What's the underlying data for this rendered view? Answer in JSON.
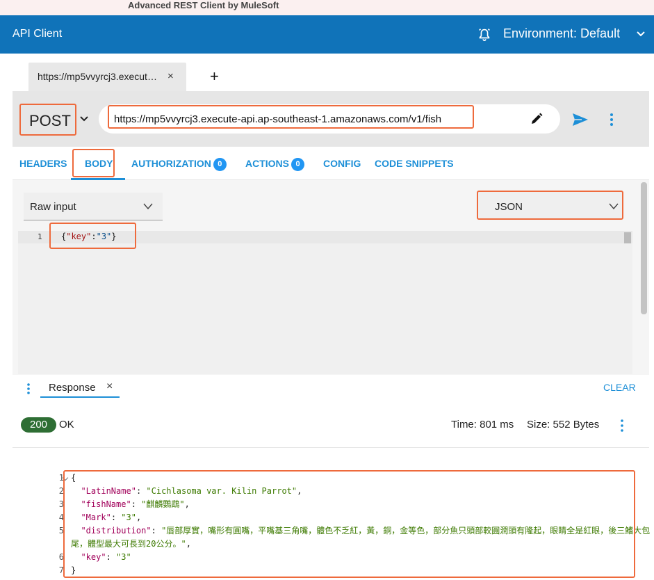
{
  "window": {
    "title": "Advanced REST Client by MuleSoft"
  },
  "appbar": {
    "title": "API Client",
    "environment": "Environment: Default",
    "icons": [
      "alarm-bell-icon",
      "chevron-down-icon"
    ]
  },
  "tabs": [
    {
      "label": "https://mp5vvyrcj3.execut…",
      "close": "×"
    }
  ],
  "add_tab": "+",
  "request": {
    "method": "POST",
    "url": "https://mp5vvyrcj3.execute-api.ap-southeast-1.amazonaws.com/v1/fish",
    "icons": [
      "pencil-icon",
      "send-icon",
      "more-vert-icon"
    ]
  },
  "request_tabs": [
    {
      "label": "HEADERS"
    },
    {
      "label": "BODY",
      "selected": true
    },
    {
      "label": "AUTHORIZATION",
      "badge": "0"
    },
    {
      "label": "ACTIONS",
      "badge": "0"
    },
    {
      "label": "CONFIG"
    },
    {
      "label": "CODE SNIPPETS"
    }
  ],
  "body_editor": {
    "input_type": "Raw input",
    "content_type": "JSON",
    "line_number": "1",
    "code": {
      "open": "{",
      "key": "\"key\"",
      "colon": ":",
      "value": "\"3\"",
      "close": "}"
    }
  },
  "response_panel": {
    "tab_label": "Response",
    "close": "×",
    "clear_label": "CLEAR",
    "status_code": "200",
    "status_text": "OK",
    "time": "Time: 801 ms",
    "size": "Size: 552 Bytes",
    "line_numbers": [
      "1",
      "2",
      "3",
      "4",
      "5",
      "6",
      "7"
    ],
    "lines": [
      {
        "text": "{"
      },
      {
        "key": "\"LatinName\"",
        "sep": ": ",
        "value": "\"Cichlasoma var. Kilin Parrot\"",
        "tail": ","
      },
      {
        "key": "\"fishName\"",
        "sep": ": ",
        "value": "\"麒麟鸚鵡\"",
        "tail": ","
      },
      {
        "key": "\"Mark\"",
        "sep": ": ",
        "value": "\"3\"",
        "tail": ","
      },
      {
        "key": "\"distribution\"",
        "sep": ": ",
        "value": "\"唇部厚實，嘴形有圓嘴，平嘴基三角嘴，體色不乏紅，黃，銅，金等色，部分魚只頭部較圓潤頭有隆起，眼睛全是紅眼，後三鰭大包尾，體型最大可長到20公分。\"",
        "tail": ","
      },
      {
        "key": "\"key\"",
        "sep": ": ",
        "value": "\"3\"",
        "tail": ""
      },
      {
        "text": "}"
      }
    ]
  },
  "colors": {
    "appbar": "#1073b9",
    "accent": "#1d8fd7",
    "highlight": "#ee6a3c",
    "status_ok": "#2e6e34"
  }
}
